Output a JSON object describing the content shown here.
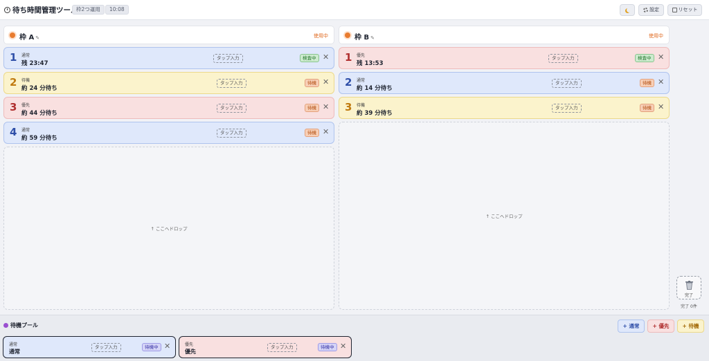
{
  "header": {
    "title": "待ち時間管理ツール",
    "mode_chip": "枠2つ運用",
    "clock": "10:08",
    "settings_label": "設定",
    "reset_label": "リセット"
  },
  "columns": [
    {
      "name": "枠 A",
      "status": "使用中",
      "tickets": [
        {
          "num": "1",
          "type": "通常",
          "time": "残 23:47",
          "tap": "タップ入力",
          "badge": "検査中",
          "kind": "normal",
          "badge_kind": "active"
        },
        {
          "num": "2",
          "type": "待機",
          "time": "約 24 分待ち",
          "tap": "タップ入力",
          "badge": "待機",
          "kind": "waiting",
          "badge_kind": "wait"
        },
        {
          "num": "3",
          "type": "優先",
          "time": "約 44 分待ち",
          "tap": "タップ入力",
          "badge": "待機",
          "kind": "priority",
          "badge_kind": "wait"
        },
        {
          "num": "4",
          "type": "通常",
          "time": "約 59 分待ち",
          "tap": "タップ入力",
          "badge": "待機",
          "kind": "normal",
          "badge_kind": "wait"
        }
      ],
      "drop_text": "↑ ここへドロップ"
    },
    {
      "name": "枠 B",
      "status": "使用中",
      "tickets": [
        {
          "num": "1",
          "type": "優先",
          "time": "残 13:53",
          "tap": "タップ入力",
          "badge": "検査中",
          "kind": "priority",
          "badge_kind": "active"
        },
        {
          "num": "2",
          "type": "通常",
          "time": "約 14 分待ち",
          "tap": "タップ入力",
          "badge": "待機",
          "kind": "normal",
          "badge_kind": "wait"
        },
        {
          "num": "3",
          "type": "待機",
          "time": "約 39 分待ち",
          "tap": "タップ入力",
          "badge": "待機",
          "kind": "waiting",
          "badge_kind": "wait"
        }
      ],
      "drop_text": "↑ ここへドロップ"
    }
  ],
  "trash": {
    "label": "完了",
    "count": "完了 0件"
  },
  "pool": {
    "title": "待機プール",
    "add_normal": "+ 通常",
    "add_priority": "+ 優先",
    "add_waiting": "+ 待機",
    "tickets": [
      {
        "type": "通常",
        "name": "通常",
        "tap": "タップ入力",
        "badge": "待機中",
        "kind": "normal"
      },
      {
        "type": "優先",
        "name": "優先",
        "tap": "タップ入力",
        "badge": "待機中",
        "kind": "priority"
      }
    ]
  },
  "colors": {
    "accent_orange": "#e87b2e",
    "normal_bg": "#dfe8fb",
    "waiting_bg": "#fbf3cc",
    "priority_bg": "#f9e0e0"
  }
}
